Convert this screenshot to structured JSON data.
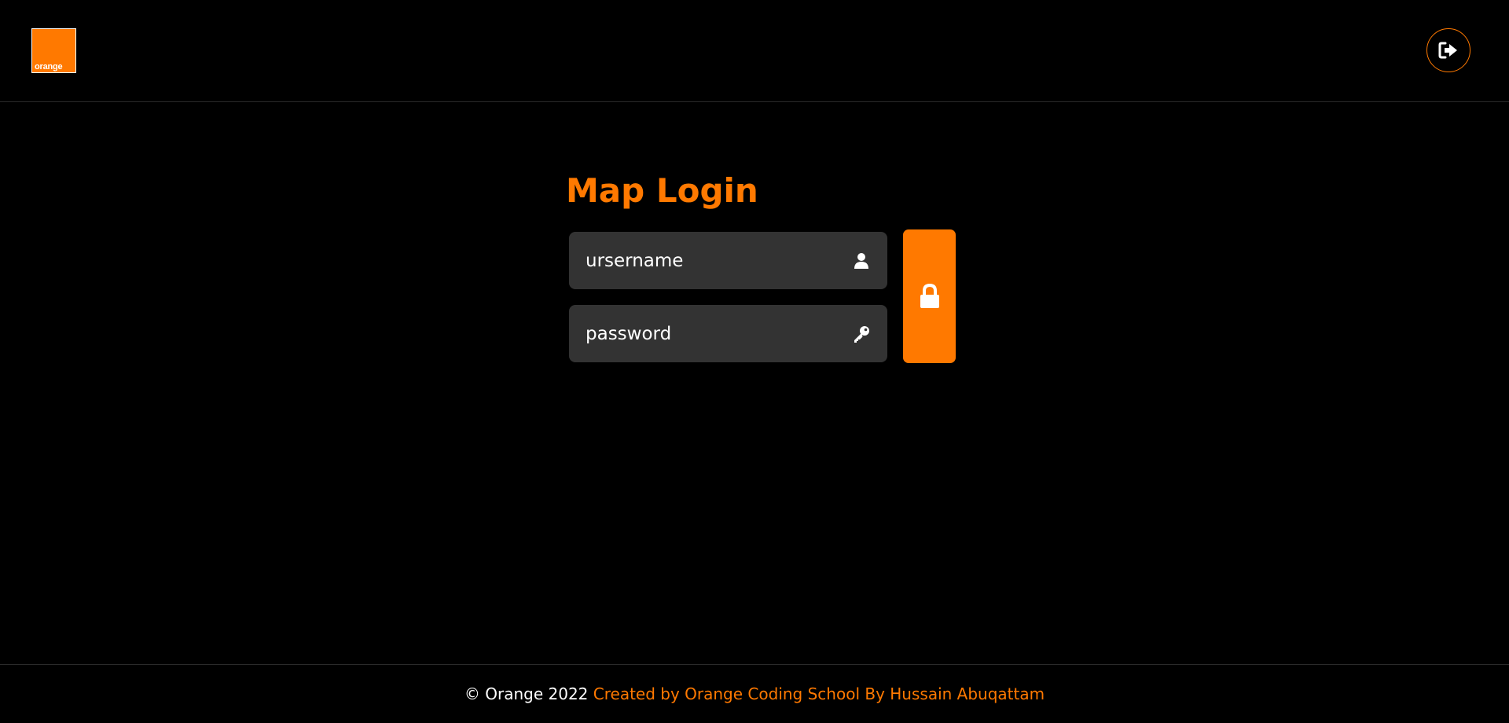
{
  "header": {
    "logo_text": "orange",
    "logout_icon": "sign-out-icon"
  },
  "login": {
    "title": "Map Login",
    "username_placeholder": "ursername",
    "password_placeholder": "password",
    "username_icon": "user-icon",
    "password_icon": "key-icon",
    "submit_icon": "lock-icon"
  },
  "footer": {
    "copyright": "© Orange 2022 ",
    "credit": "Created by Orange Coding School By Hussain Abuqattam"
  },
  "colors": {
    "accent": "#ff7900",
    "background": "#000000",
    "field_background": "#333333",
    "text": "#ffffff"
  }
}
